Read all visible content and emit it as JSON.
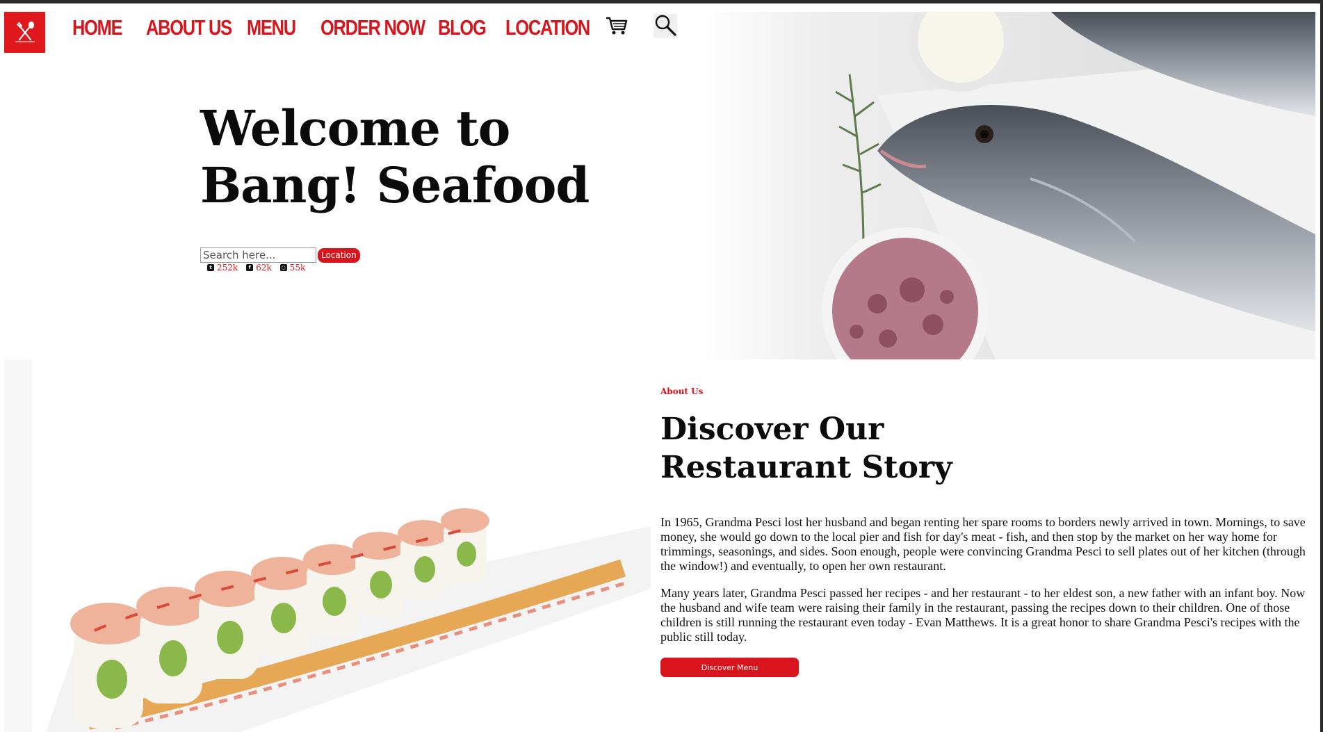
{
  "nav": {
    "items": [
      {
        "label": "HOME"
      },
      {
        "label": "ABOUT US"
      },
      {
        "label": "MENU"
      },
      {
        "label": "ORDER NOW"
      },
      {
        "label": "BLOG"
      },
      {
        "label": "LOCATION"
      }
    ],
    "icons": [
      "cart-icon",
      "search-icon"
    ]
  },
  "hero": {
    "title_line1": "Welcome to",
    "title_line2": "Bang! Seafood",
    "search_placeholder": "Search here...",
    "location_button": "Location",
    "social": [
      {
        "icon": "twitter-icon",
        "count": "252k"
      },
      {
        "icon": "facebook-icon",
        "count": "62k"
      },
      {
        "icon": "instagram-icon",
        "count": "55k"
      }
    ]
  },
  "about": {
    "label": "About Us",
    "title_line1": "Discover Our",
    "title_line2": "Restaurant Story",
    "paragraph1": "In 1965, Grandma Pesci lost her husband and began renting her spare rooms to borders newly arrived in town. Mornings, to save money, she would go down to the local pier and fish for day's meat - fish, and then stop by the market on her way home for trimmings, seasonings, and sides. Soon enough, people were convincing Grandma Pesci to sell plates out of her kitchen (through the window!) and eventually, to open her own restaurant.",
    "paragraph2": "Many years later, Grandma Pesci passed her recipes - and her restaurant - to her eldest son, a new father with an infant boy. Now the husband and wife team were raising their family in the restaurant, passing the recipes down to their children. One of those children is still running the restaurant even today - Evan Matthews. It is a great honor to share Grandma Pesci's recipes with the public still today.",
    "button": "Discover Menu"
  },
  "colors": {
    "accent": "#d8141c",
    "text": "#0b0b0b"
  }
}
